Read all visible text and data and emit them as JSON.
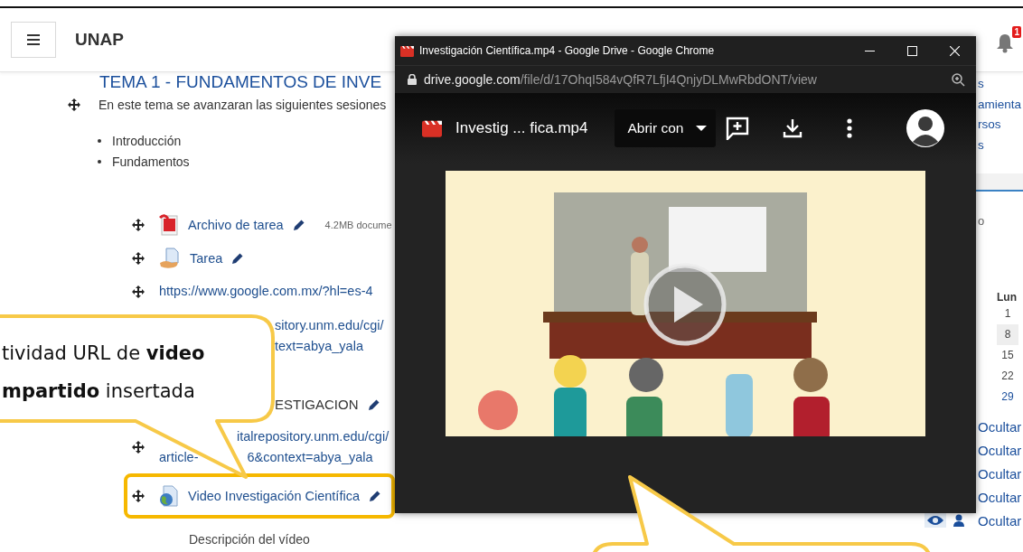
{
  "header": {
    "site_name": "UNAP",
    "notification_count": "1"
  },
  "course": {
    "section_title": "TEMA 1 - FUNDAMENTOS DE INVE",
    "summary": "En este tema se avanzaran las siguientes sesiones",
    "topics": [
      "Introducción",
      "Fundamentos"
    ],
    "activities": [
      {
        "kind": "file",
        "title": "Archivo de tarea",
        "editable": true,
        "info": "4.2MB docume"
      },
      {
        "kind": "assignment",
        "title": "Tarea",
        "editable": true
      },
      {
        "kind": "url",
        "lines": [
          [
            "https://www.google.com.mx/?hl=es-4"
          ]
        ]
      },
      {
        "kind": "url_covered",
        "lines": [
          [
            "sitory.unm.edu/cgi/"
          ],
          [
            "text=abya_yala"
          ]
        ]
      },
      {
        "kind": "heading",
        "title": "ESTIGACION",
        "editable": true
      },
      {
        "kind": "url_split",
        "lines": [
          [
            "italrepository.unm.edu/cgi/"
          ],
          [
            "article-",
            "6&context=abya_yala"
          ]
        ]
      },
      {
        "kind": "url_resource",
        "title": "Video Investigación Científica",
        "editable": true,
        "highlighted": true
      },
      {
        "kind": "description",
        "title": "Descripción del vídeo"
      }
    ]
  },
  "side": {
    "block_fragments": [
      "s",
      "amienta",
      "rsos",
      "s"
    ],
    "calendar": {
      "fragment": "o",
      "weekday": "Lun",
      "days": [
        {
          "label": "1",
          "today": false,
          "has_event": false
        },
        {
          "label": "8",
          "today": true,
          "has_event": false
        },
        {
          "label": "15",
          "today": false,
          "has_event": false
        },
        {
          "label": "22",
          "today": false,
          "has_event": false
        },
        {
          "label": "29",
          "today": false,
          "has_event": true
        }
      ]
    },
    "visibility_rows": [
      {
        "label": "Ocultar",
        "kind": "plain"
      },
      {
        "label": "Ocultar",
        "kind": "plain"
      },
      {
        "label": "Ocultar",
        "kind": "plain"
      },
      {
        "label": "Ocultar",
        "kind": "plain"
      },
      {
        "label": "Ocultar",
        "kind": "with_controls"
      }
    ]
  },
  "browser": {
    "title": "Investigación Científica.mp4 - Google Drive - Google Chrome",
    "url_host": "drive.google.com",
    "url_path": "/file/d/17OhqI584vQfR7LfjI4QnjyDLMwRbdONT/view",
    "file_name": "Investig ... fica.mp4",
    "open_with": "Abrir con"
  },
  "callout": {
    "text": "tividad URL de **video**\n**mpartido** insertada"
  }
}
